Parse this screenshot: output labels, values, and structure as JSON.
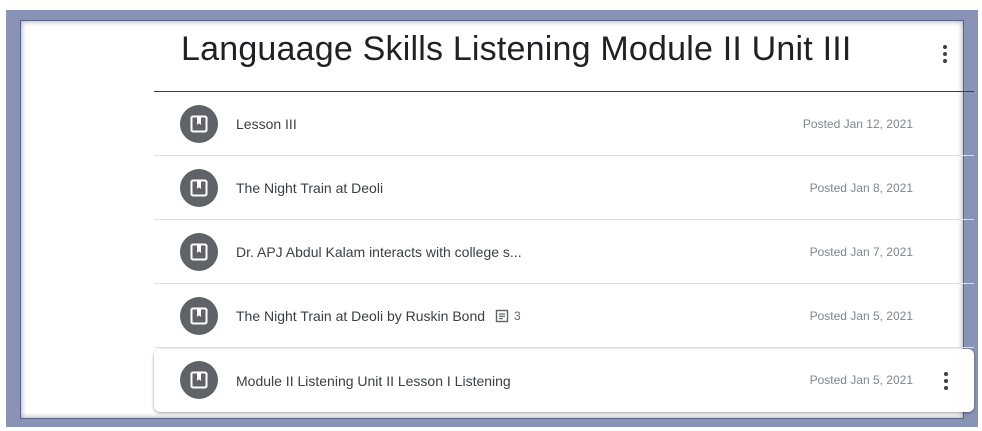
{
  "topic": {
    "title": "Languaage Skills Listening Module II Unit III"
  },
  "items": [
    {
      "title": "Lesson III",
      "posted": "Posted Jan 12, 2021"
    },
    {
      "title": "The Night Train at Deoli",
      "posted": "Posted Jan 8, 2021"
    },
    {
      "title": "Dr. APJ Abdul Kalam interacts with college s...",
      "posted": "Posted Jan 7, 2021"
    },
    {
      "title": "The Night Train at Deoli by Ruskin Bond",
      "posted": "Posted Jan 5, 2021",
      "comment_count": "3"
    },
    {
      "title": "Module II Listening Unit II Lesson I Listening",
      "posted": "Posted Jan 5, 2021"
    }
  ],
  "icons": {
    "material": "bookmark-icon",
    "comment": "comment-icon",
    "menu": "more-vert-icon"
  },
  "colors": {
    "frame": "#8893b5",
    "avatar": "#5f6368",
    "title_text": "#202124",
    "meta_text": "#80868b"
  }
}
